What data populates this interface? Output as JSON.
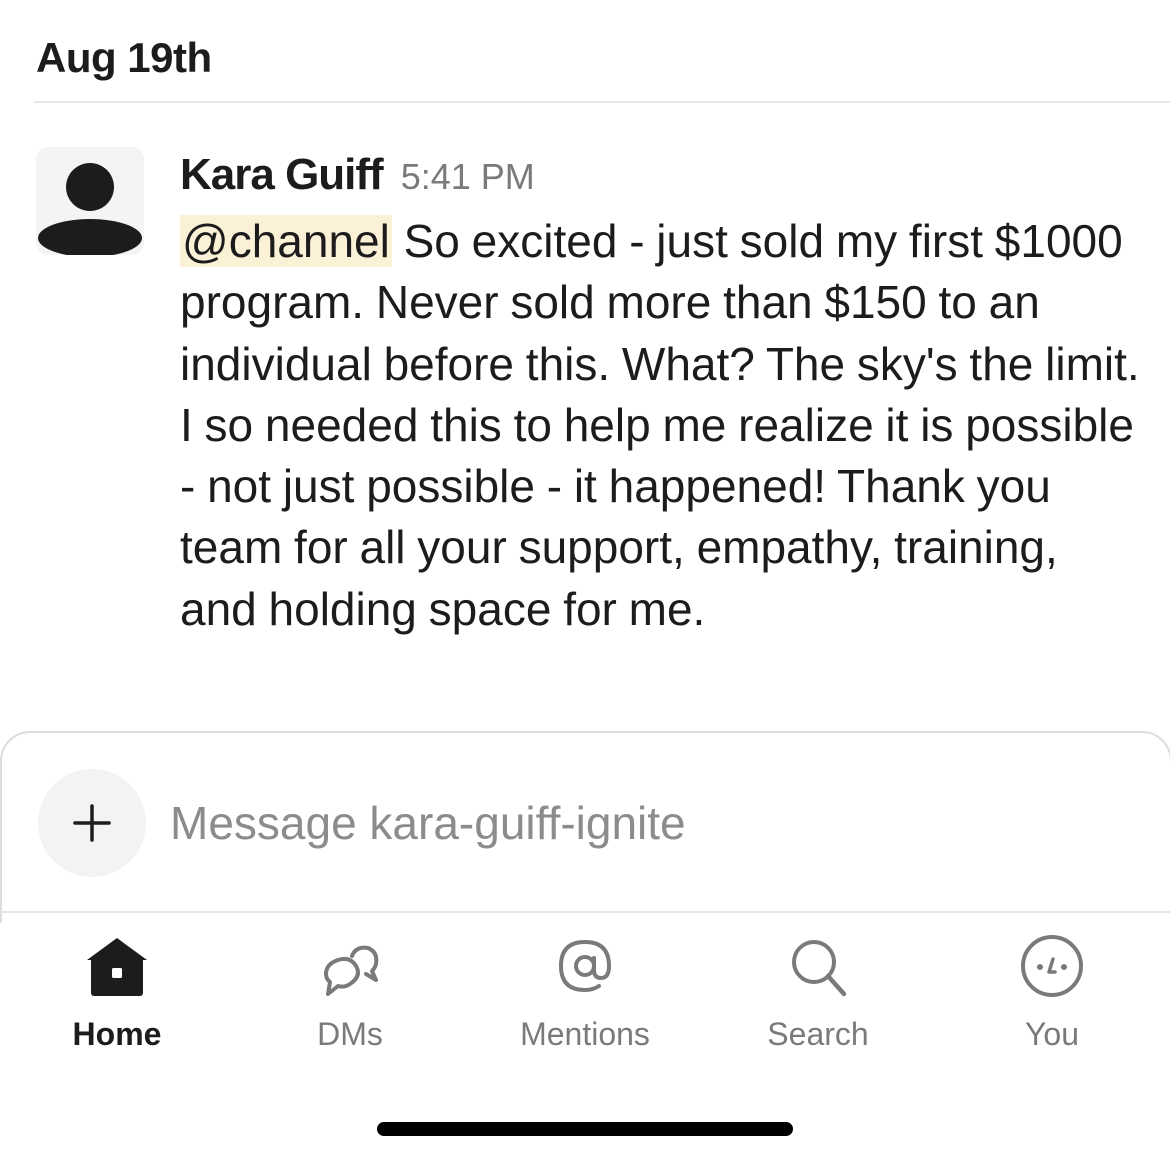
{
  "date_header": "Aug 19th",
  "message": {
    "author": "Kara Guiff",
    "time": "5:41 PM",
    "mention": "@channel",
    "text": " So excited - just sold my first $1000 program. Never sold more than $150 to an individual before this. What? The sky's the limit. I so needed this to help me realize it is possible - not just possible - it happened! Thank you team for all your support, empathy, training, and holding space for me."
  },
  "composer": {
    "placeholder": "Message kara-guiff-ignite",
    "value": ""
  },
  "tabs": [
    {
      "label": "Home",
      "icon": "home-icon",
      "active": true
    },
    {
      "label": "DMs",
      "icon": "dms-icon",
      "active": false
    },
    {
      "label": "Mentions",
      "icon": "mentions-icon",
      "active": false
    },
    {
      "label": "Search",
      "icon": "search-icon",
      "active": false
    },
    {
      "label": "You",
      "icon": "you-icon",
      "active": false
    }
  ],
  "colors": {
    "mention_highlight": "#fbf1d7",
    "text": "#1d1c1d",
    "muted": "#7a7a7a"
  }
}
